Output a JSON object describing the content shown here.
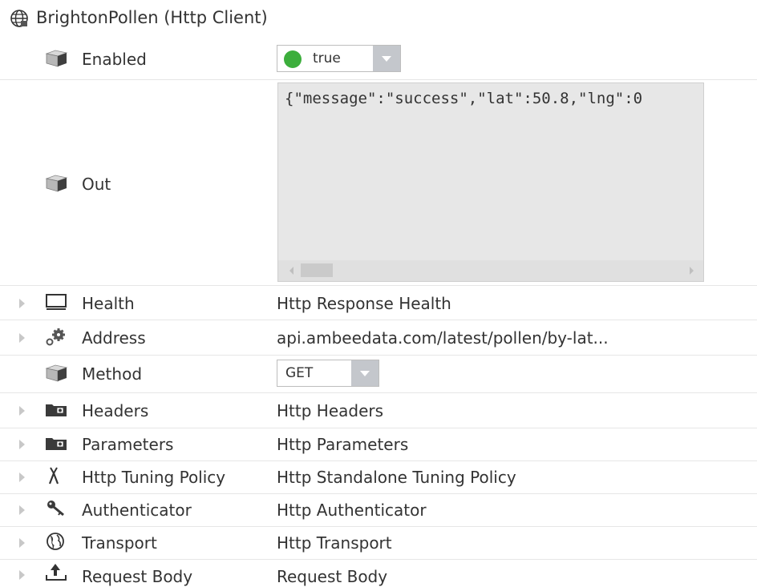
{
  "header": {
    "title": "BrightonPollen  (Http Client)",
    "icon": "globe-icon"
  },
  "enabled": {
    "label": "Enabled",
    "value": "true",
    "status_color": "#3cae3c"
  },
  "out": {
    "label": "Out",
    "text": "{\"message\":\"success\",\"lat\":50.8,\"lng\":0"
  },
  "health": {
    "label": "Health",
    "value": "Http Response Health"
  },
  "address": {
    "label": "Address",
    "value": "api.ambeedata.com/latest/pollen/by-lat..."
  },
  "method": {
    "label": "Method",
    "value": "GET"
  },
  "headers": {
    "label": "Headers",
    "value": "Http Headers"
  },
  "parameters": {
    "label": "Parameters",
    "value": "Http Parameters"
  },
  "tuning": {
    "label": "Http Tuning Policy",
    "value": "Http Standalone Tuning Policy"
  },
  "authenticator": {
    "label": "Authenticator",
    "value": "Http Authenticator"
  },
  "transport": {
    "label": "Transport",
    "value": "Http Transport"
  },
  "request_body": {
    "label": "Request Body",
    "value": "Request Body"
  }
}
